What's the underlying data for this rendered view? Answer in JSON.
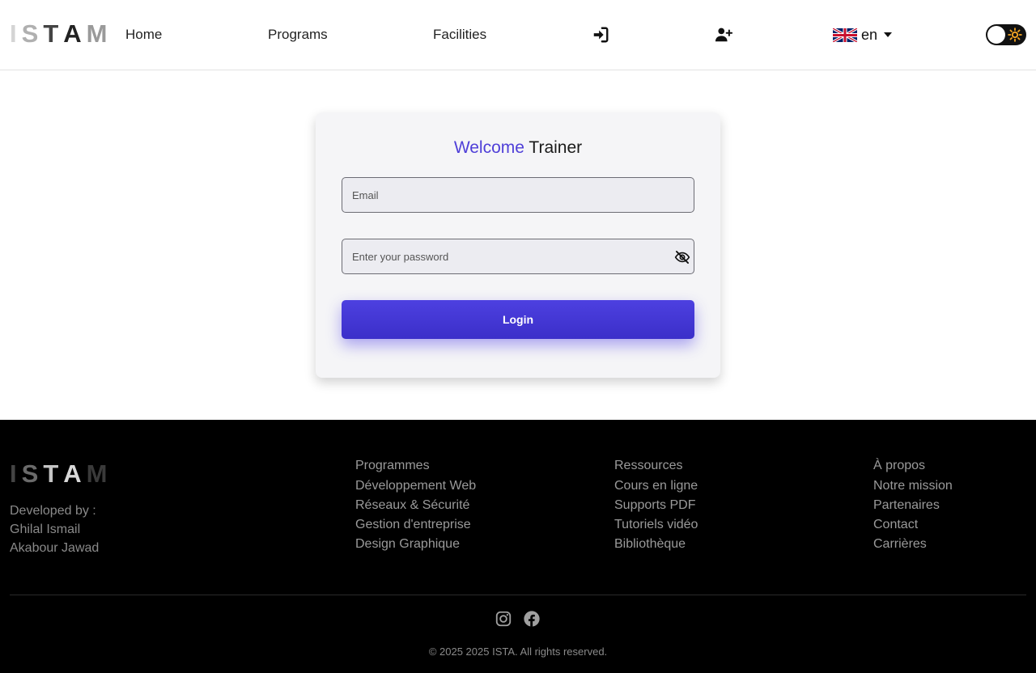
{
  "nav": {
    "logo": [
      "I",
      "S",
      "T",
      "A",
      "M"
    ],
    "links": {
      "home": "Home",
      "programs": "Programs",
      "facilities": "Facilities"
    },
    "icons": {
      "login": "sign-in-icon",
      "register": "user-plus-icon",
      "theme": "sun-icon"
    },
    "language": {
      "flag": "uk-flag-icon",
      "code": "en"
    }
  },
  "login": {
    "title_highlight": "Welcome",
    "title_rest": "Trainer",
    "email_placeholder": "Email",
    "email_value": "",
    "password_placeholder": "Enter your password",
    "password_value": "",
    "button": "Login"
  },
  "footer": {
    "logo": [
      "I",
      "S",
      "T",
      "A",
      "M"
    ],
    "developed_by": "Developed by :",
    "developers": [
      "Ghilal Ismail",
      "Akabour Jawad"
    ],
    "columns": [
      {
        "heading": "Programmes",
        "items": [
          "Développement Web",
          "Réseaux & Sécurité",
          "Gestion d'entreprise",
          "Design Graphique"
        ]
      },
      {
        "heading": "Ressources",
        "items": [
          "Cours en ligne",
          "Supports PDF",
          "Tutoriels vidéo",
          "Bibliothèque"
        ]
      },
      {
        "heading": "À propos",
        "items": [
          "Notre mission",
          "Partenaires",
          "Contact",
          "Carrières"
        ]
      }
    ],
    "social": [
      "instagram-icon",
      "facebook-icon"
    ],
    "copyright": "© 2025 2025 ISTA. All rights reserved."
  },
  "colors": {
    "accent": "#4f3fd8",
    "button": "#4338ca",
    "footer_bg": "#000000"
  }
}
